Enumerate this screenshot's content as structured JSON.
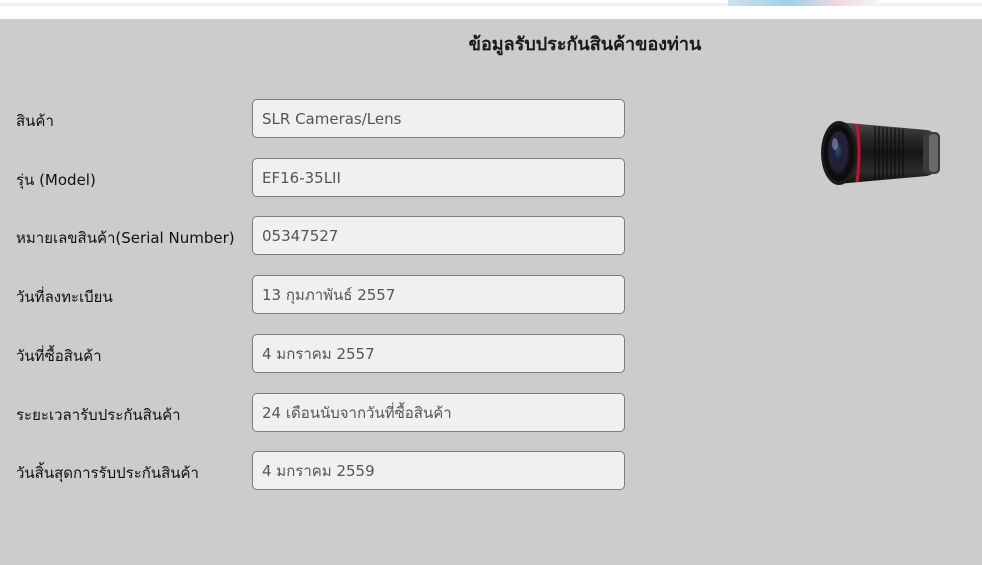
{
  "page": {
    "title": "ข้อมูลรับประกันสินค้าของท่าน"
  },
  "fields": [
    {
      "label": "สินค้า",
      "value": "SLR Cameras/Lens"
    },
    {
      "label": "รุ่น (Model)",
      "value": "EF16-35LII"
    },
    {
      "label": "หมายเลขสินค้า(Serial Number)",
      "value": "05347527"
    },
    {
      "label": "วันที่ลงทะเบียน",
      "value": "13 กุมภาพันธ์ 2557"
    },
    {
      "label": "วันที่ซื้อสินค้า",
      "value": "4 มกราคม 2557"
    },
    {
      "label": "ระยะเวลารับประกันสินค้า",
      "value": "24 เดือนนับจากวันที่ซื้อสินค้า"
    },
    {
      "label": "วันสิ้นสุดการรับประกันสินค้า",
      "value": "4 มกราคม 2559"
    }
  ],
  "product_image": {
    "icon": "camera-lens-image"
  },
  "colors": {
    "panel_background": "#cccccc",
    "field_background": "#f0f0f0",
    "field_border": "#7d7d7d",
    "accent_ring": "#c8102e"
  }
}
